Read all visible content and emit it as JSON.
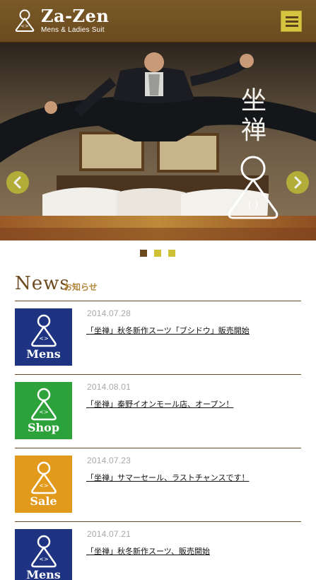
{
  "header": {
    "brand_name": "Za-Zen",
    "brand_sub": "Mens & Ladies Suit"
  },
  "hero": {
    "vertical_text": [
      "坐",
      "禅"
    ]
  },
  "carousel": {
    "dots": [
      {
        "active": true,
        "color": "#6a4a1e"
      },
      {
        "active": false,
        "color": "#cfc136"
      },
      {
        "active": false,
        "color": "#cfc136"
      }
    ]
  },
  "news": {
    "title": "News",
    "subtitle": "お知らせ",
    "items": [
      {
        "category": "Mens",
        "color": "#1e3482",
        "date": "2014.07.28",
        "headline": "「坐禅」秋冬新作スーツ「ブシドウ」販売開始"
      },
      {
        "category": "Shop",
        "color": "#2ea23a",
        "date": "2014.08.01",
        "headline": "「坐禅」秦野イオンモール店、オープン！"
      },
      {
        "category": "Sale",
        "color": "#e29a1c",
        "date": "2014.07.23",
        "headline": "「坐禅」サマーセール、ラストチャンスです！"
      },
      {
        "category": "Mens",
        "color": "#1e3482",
        "date": "2014.07.21",
        "headline": "「坐禅」秋冬新作スーツ、販売開始"
      }
    ]
  }
}
